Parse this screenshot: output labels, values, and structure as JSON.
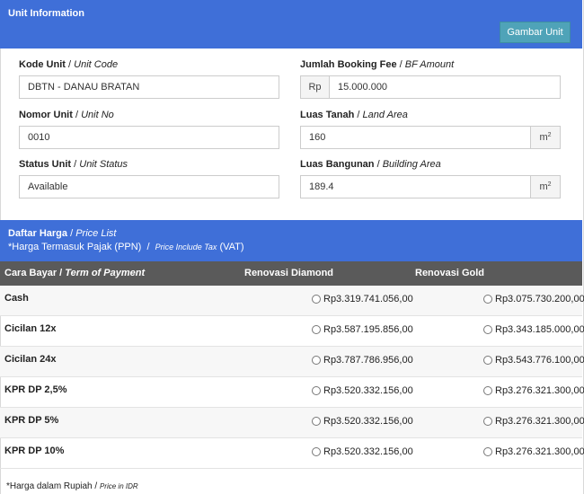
{
  "unit_info": {
    "title": "Unit Information",
    "gambar_button": "Gambar Unit",
    "kode_unit": {
      "label": "Kode Unit",
      "label_en": "Unit Code",
      "value": "DBTN - DANAU BRATAN"
    },
    "nomor_unit": {
      "label": "Nomor Unit",
      "label_en": "Unit No",
      "value": "0010"
    },
    "status_unit": {
      "label": "Status Unit",
      "label_en": "Unit Status",
      "value": "Available"
    },
    "booking_fee": {
      "label": "Jumlah Booking Fee",
      "label_en": "BF Amount",
      "prefix": "Rp",
      "value": "15.000.000"
    },
    "luas_tanah": {
      "label": "Luas Tanah",
      "label_en": "Land Area",
      "value": "160",
      "unit": "m",
      "unit_sup": "2"
    },
    "luas_bangunan": {
      "label": "Luas Bangunan",
      "label_en": "Building Area",
      "value": "189.4",
      "unit": "m",
      "unit_sup": "2"
    },
    "separator": "/"
  },
  "price_list": {
    "title": "Daftar Harga",
    "title_en": "Price List",
    "tax_note": "*Harga Termasuk Pajak (PPN)",
    "tax_note_en": "Price Include Tax",
    "tax_note_en_suffix": "(VAT)",
    "separator": "/",
    "columns": {
      "term": "Cara Bayar",
      "term_en": "Term of Payment",
      "diamond": "Renovasi Diamond",
      "gold": "Renovasi Gold"
    },
    "rows": [
      {
        "term": "Cash",
        "diamond": "Rp3.319.741.056,00",
        "gold": "Rp3.075.730.200,00"
      },
      {
        "term": "Cicilan 12x",
        "diamond": "Rp3.587.195.856,00",
        "gold": "Rp3.343.185.000,00"
      },
      {
        "term": "Cicilan 24x",
        "diamond": "Rp3.787.786.956,00",
        "gold": "Rp3.543.776.100,00"
      },
      {
        "term": "KPR DP 2,5%",
        "diamond": "Rp3.520.332.156,00",
        "gold": "Rp3.276.321.300,00"
      },
      {
        "term": "KPR DP 5%",
        "diamond": "Rp3.520.332.156,00",
        "gold": "Rp3.276.321.300,00"
      },
      {
        "term": "KPR DP 10%",
        "diamond": "Rp3.520.332.156,00",
        "gold": "Rp3.276.321.300,00"
      }
    ],
    "footnote": "*Harga dalam Rupiah",
    "footnote_en": "Price in IDR"
  },
  "colors": {
    "header_blue": "#3f6fd8",
    "button_teal": "#4fa3b8",
    "table_header": "#5a5a5a"
  }
}
